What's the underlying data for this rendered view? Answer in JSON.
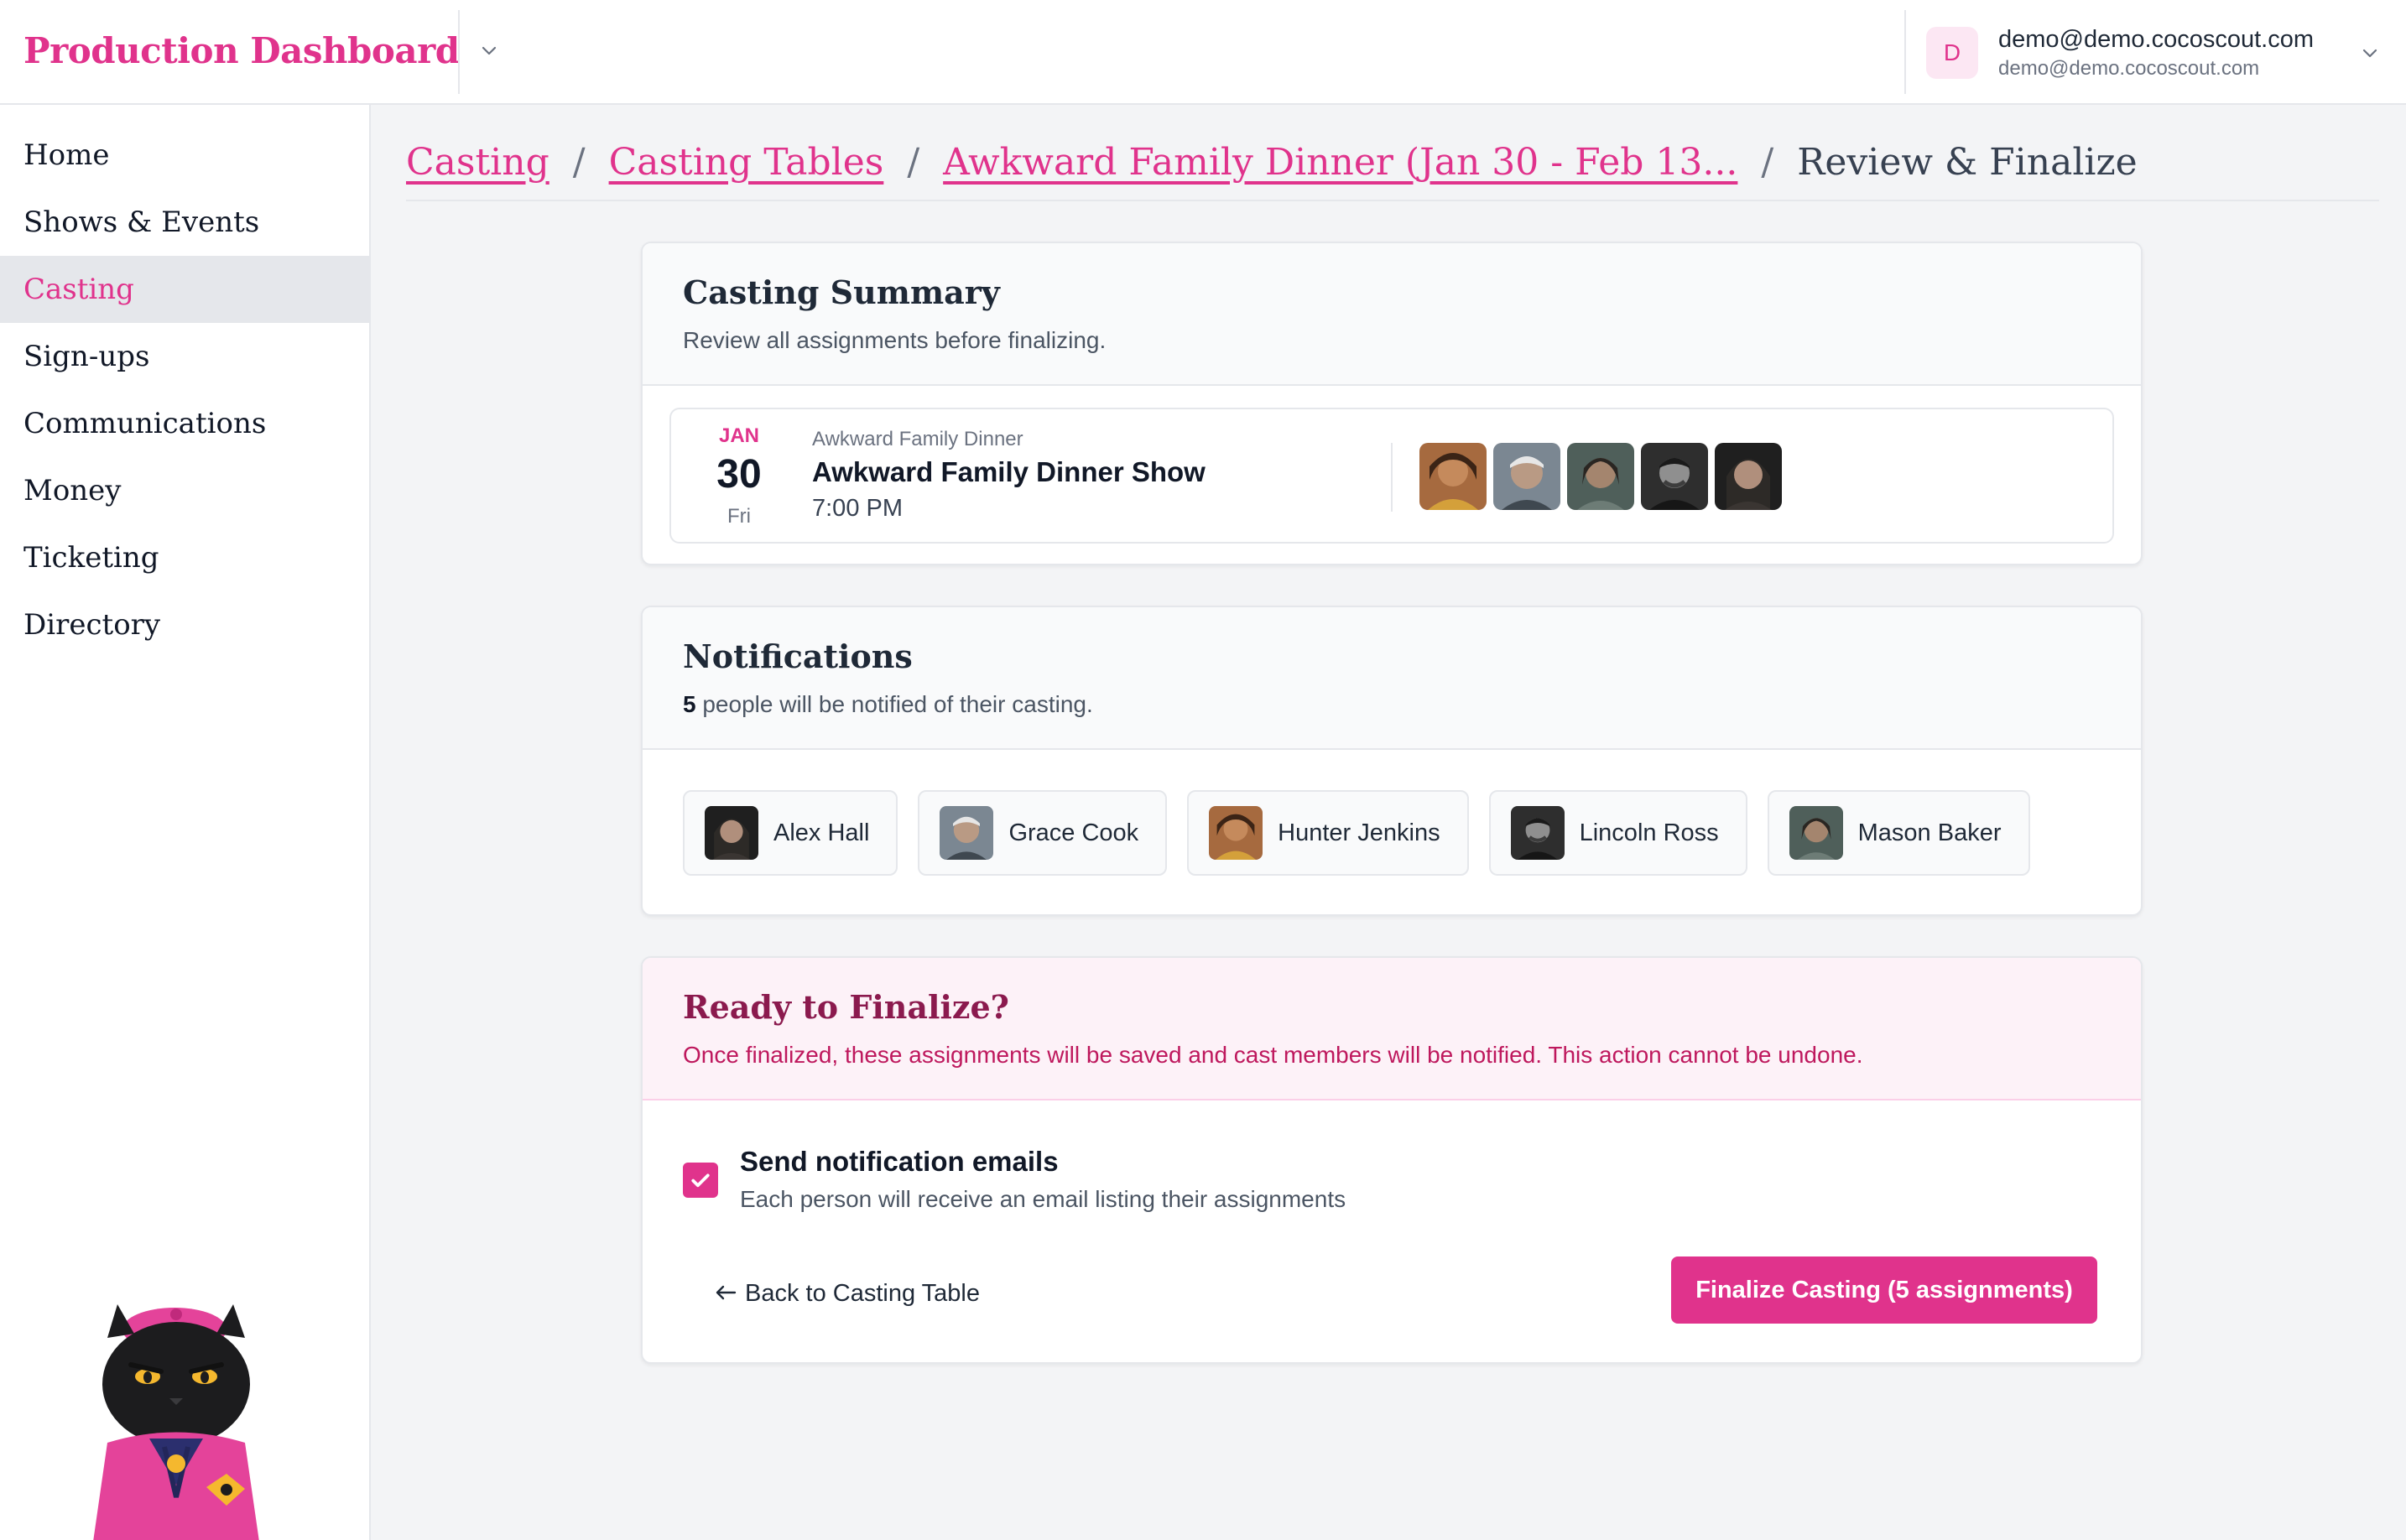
{
  "app": {
    "title": "Production Dashboard",
    "accent": "#e0338c"
  },
  "user": {
    "initial": "D",
    "name": "demo@demo.cocoscout.com",
    "email": "demo@demo.cocoscout.com"
  },
  "sidebar": {
    "items": [
      {
        "label": "Home",
        "active": false
      },
      {
        "label": "Shows & Events",
        "active": false
      },
      {
        "label": "Casting",
        "active": true
      },
      {
        "label": "Sign-ups",
        "active": false
      },
      {
        "label": "Communications",
        "active": false
      },
      {
        "label": "Money",
        "active": false
      },
      {
        "label": "Ticketing",
        "active": false
      },
      {
        "label": "Directory",
        "active": false
      }
    ]
  },
  "breadcrumb": {
    "items": [
      "Casting",
      "Casting Tables",
      "Awkward Family Dinner (Jan 30 - Feb 13..."
    ],
    "separator": "/",
    "current": "Review & Finalize"
  },
  "summary": {
    "title": "Casting Summary",
    "subtitle": "Review all assignments before finalizing.",
    "event": {
      "month": "JAN",
      "day": "30",
      "weekday": "Fri",
      "series": "Awkward Family Dinner",
      "name": "Awkward Family Dinner Show",
      "time": "7:00 PM"
    }
  },
  "notifications": {
    "title": "Notifications",
    "count": "5",
    "subtitle_rest": " people will be notified of their casting.",
    "people": [
      {
        "name": "Alex Hall"
      },
      {
        "name": "Grace Cook"
      },
      {
        "name": "Hunter Jenkins"
      },
      {
        "name": "Lincoln Ross"
      },
      {
        "name": "Mason Baker"
      }
    ]
  },
  "finalize": {
    "title": "Ready to Finalize?",
    "warning": "Once finalized, these assignments will be saved and cast members will be notified. This action cannot be undone.",
    "checkbox_checked": true,
    "checkbox_label": "Send notification emails",
    "checkbox_help": "Each person will receive an email listing their assignments",
    "back_label": "Back to Casting Table",
    "finalize_label": "Finalize Casting (5 assignments)"
  }
}
